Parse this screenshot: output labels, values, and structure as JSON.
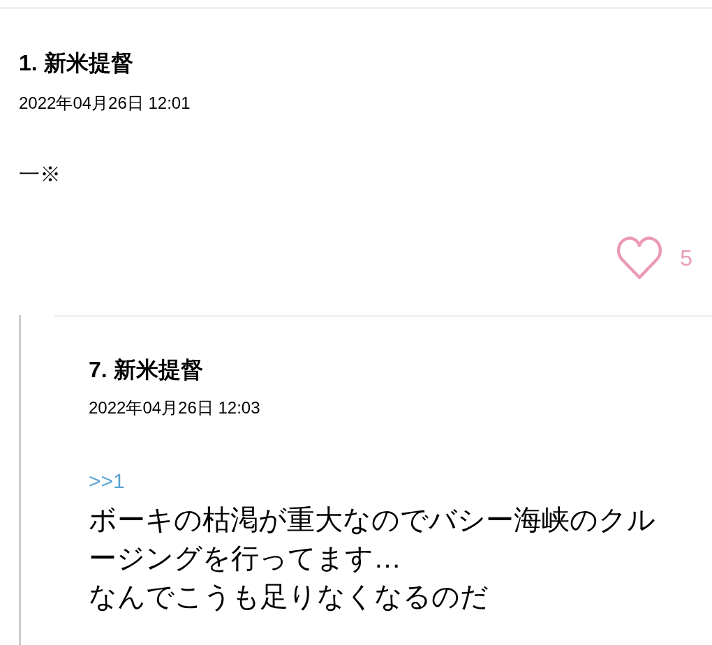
{
  "post": {
    "title": "1. 新米提督",
    "date": "2022年04月26日 12:01",
    "body": "一※",
    "like_count": "5"
  },
  "replies": [
    {
      "title": "7. 新米提督",
      "date": "2022年04月26日 12:03",
      "reply_to": ">>1",
      "body": "ボーキの枯渇が重大なのでバシー海峡のクルージングを行ってます…\nなんでこうも足りなくなるのだ"
    }
  ]
}
